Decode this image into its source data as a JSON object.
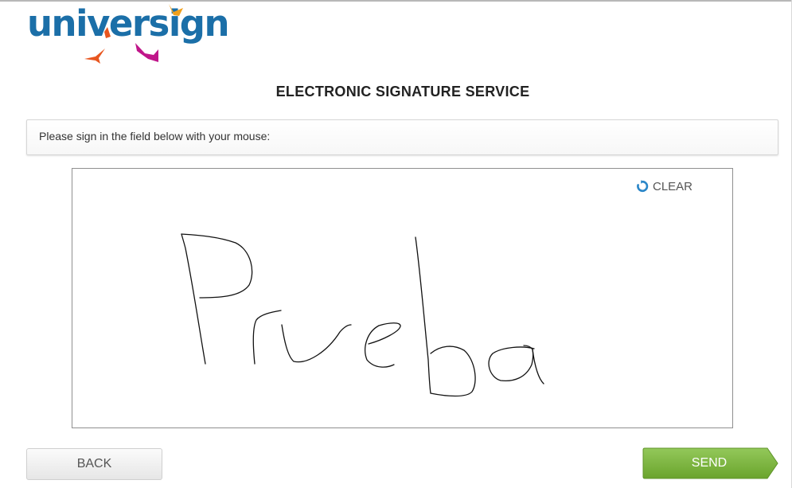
{
  "logo": {
    "text": "universign",
    "part1": "univer",
    "part2": "sign"
  },
  "page": {
    "title": "ELECTRONIC SIGNATURE SERVICE",
    "instruction": "Please sign in the field below with your mouse:"
  },
  "signature_pad": {
    "clear_label": "CLEAR",
    "clear_icon": "refresh-icon",
    "signature_content": "Prueba"
  },
  "actions": {
    "back_label": "BACK",
    "send_label": "SEND"
  },
  "colors": {
    "brand_blue": "#1b6fa8",
    "logo_orange": "#e8561f",
    "logo_magenta": "#c0168a",
    "send_green": "#7ab43a",
    "clear_icon_blue": "#2a86c8"
  }
}
